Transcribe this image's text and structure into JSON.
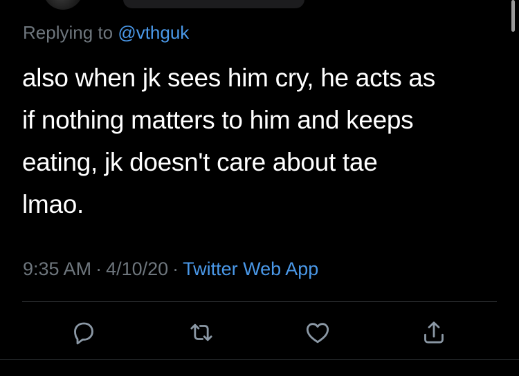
{
  "reply": {
    "prefix": "Replying to",
    "handle": "@vthguk"
  },
  "tweet": {
    "line1": "also when jk sees him cry, he acts as",
    "line2": "if nothing matters to him and keeps",
    "line3": "eating, jk doesn't care about tae",
    "line4": "lmao."
  },
  "meta": {
    "time": "9:35 AM",
    "separator1": "·",
    "date": "4/10/20",
    "separator2": "·",
    "source": "Twitter Web App"
  },
  "actions": [
    {
      "icon": "reply-icon"
    },
    {
      "icon": "retweet-icon"
    },
    {
      "icon": "like-icon"
    },
    {
      "icon": "share-icon"
    }
  ],
  "colors": {
    "background": "#000000",
    "text": "#ffffff",
    "secondary": "#6e767d",
    "link": "#4a98e8",
    "icon": "#8b98a5"
  }
}
